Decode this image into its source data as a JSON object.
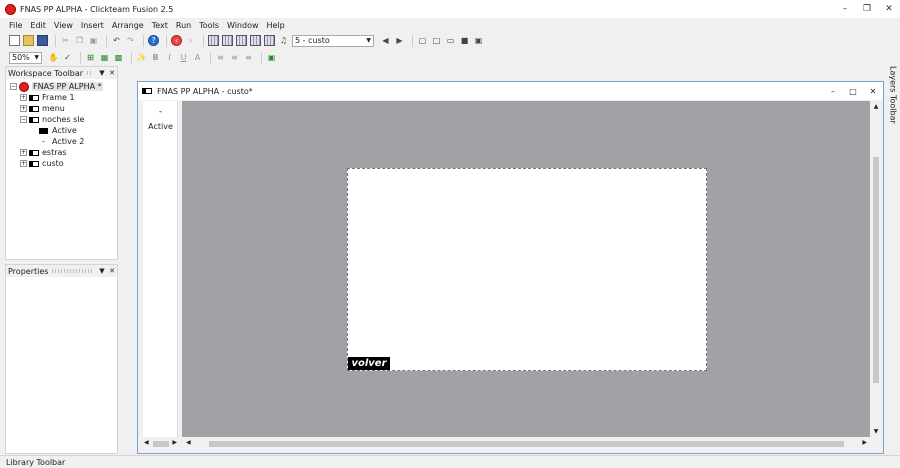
{
  "window": {
    "title": "FNAS PP ALPHA - Clickteam Fusion 2.5"
  },
  "menu": [
    "File",
    "Edit",
    "View",
    "Insert",
    "Arrange",
    "Text",
    "Run",
    "Tools",
    "Window",
    "Help"
  ],
  "toolbar": {
    "frame_select": "5 - custo",
    "zoom": "50%"
  },
  "workspace": {
    "title": "Workspace Toolbar",
    "project": "FNAS PP ALPHA *",
    "frames": [
      "Frame 1",
      "menu",
      "noches sle",
      "estras",
      "custo"
    ],
    "noches_children": [
      "Active",
      "Active 2"
    ]
  },
  "properties": {
    "title": "Properties"
  },
  "library": {
    "title": "Library Toolbar"
  },
  "layers": {
    "title": "Layers Toolbar"
  },
  "editor": {
    "title": "FNAS PP ALPHA - custo*",
    "objlist_dash": "-",
    "objlist_item": "Active",
    "volver_text": "volver"
  }
}
